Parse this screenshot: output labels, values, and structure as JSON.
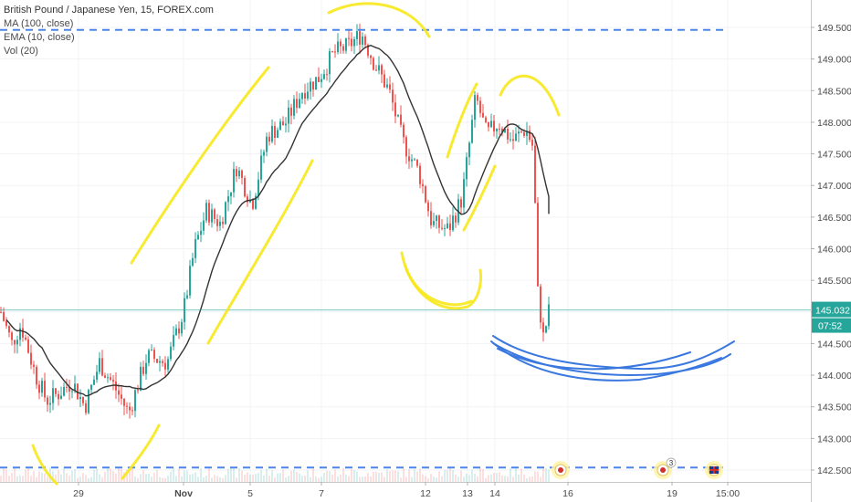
{
  "legend": {
    "title": "British Pound / Japanese Yen, 15, FOREX.com",
    "ma": "MA (100, close)",
    "ema": "EMA (10, close)",
    "vol": "Vol (20)"
  },
  "price_labels": {
    "current_price": "145.032",
    "countdown": "07:52",
    "current_color": "#26a69a"
  },
  "colors": {
    "up_candle": "#26a69a",
    "down_candle": "#ef5350",
    "ma_line": "#333333",
    "level_line": "#4a86e8",
    "yellow_drawing": "#f7e81a",
    "blue_drawing": "#3a78e0",
    "event_icon": "#fff3a8"
  },
  "chart_data": {
    "type": "candlestick",
    "title": "British Pound / Japanese Yen, 15, FOREX.com",
    "y_ticks": [
      "142.500",
      "143.000",
      "143.500",
      "144.000",
      "144.500",
      "145.000",
      "145.500",
      "146.000",
      "146.500",
      "147.000",
      "147.500",
      "148.000",
      "148.500",
      "149.000",
      "149.500"
    ],
    "x_ticks": [
      "29",
      "Nov",
      "5",
      "7",
      "12",
      "13",
      "14",
      "16",
      "19",
      "15:00"
    ],
    "ylim": [
      142.45,
      149.75
    ],
    "levels": [
      149.46,
      142.54
    ],
    "current_price": 145.032,
    "price_anchors": [
      [
        0,
        145.0
      ],
      [
        12,
        144.5
      ],
      [
        22,
        144.8
      ],
      [
        38,
        144.0
      ],
      [
        50,
        143.6
      ],
      [
        62,
        143.7
      ],
      [
        78,
        143.9
      ],
      [
        92,
        143.5
      ],
      [
        108,
        144.2
      ],
      [
        125,
        143.8
      ],
      [
        140,
        143.4
      ],
      [
        160,
        144.3
      ],
      [
        182,
        144.2
      ],
      [
        200,
        145.0
      ],
      [
        212,
        146.0
      ],
      [
        225,
        146.6
      ],
      [
        240,
        146.4
      ],
      [
        258,
        147.3
      ],
      [
        275,
        146.7
      ],
      [
        292,
        147.8
      ],
      [
        312,
        148.0
      ],
      [
        330,
        148.5
      ],
      [
        348,
        148.7
      ],
      [
        365,
        149.1
      ],
      [
        380,
        149.2
      ],
      [
        395,
        149.4
      ],
      [
        410,
        148.9
      ],
      [
        425,
        148.5
      ],
      [
        440,
        147.7
      ],
      [
        458,
        147.2
      ],
      [
        472,
        146.4
      ],
      [
        490,
        146.3
      ],
      [
        505,
        146.8
      ],
      [
        520,
        148.4
      ],
      [
        532,
        147.8
      ],
      [
        545,
        148.0
      ],
      [
        560,
        147.7
      ],
      [
        575,
        147.9
      ],
      [
        583,
        147.6
      ],
      [
        588,
        145.3
      ],
      [
        594,
        144.6
      ],
      [
        600,
        145.0
      ]
    ]
  },
  "markers": [
    {
      "name": "event-marker-1",
      "label": ""
    },
    {
      "name": "event-marker-2",
      "label": "3"
    },
    {
      "name": "event-marker-uk",
      "label": ""
    }
  ]
}
